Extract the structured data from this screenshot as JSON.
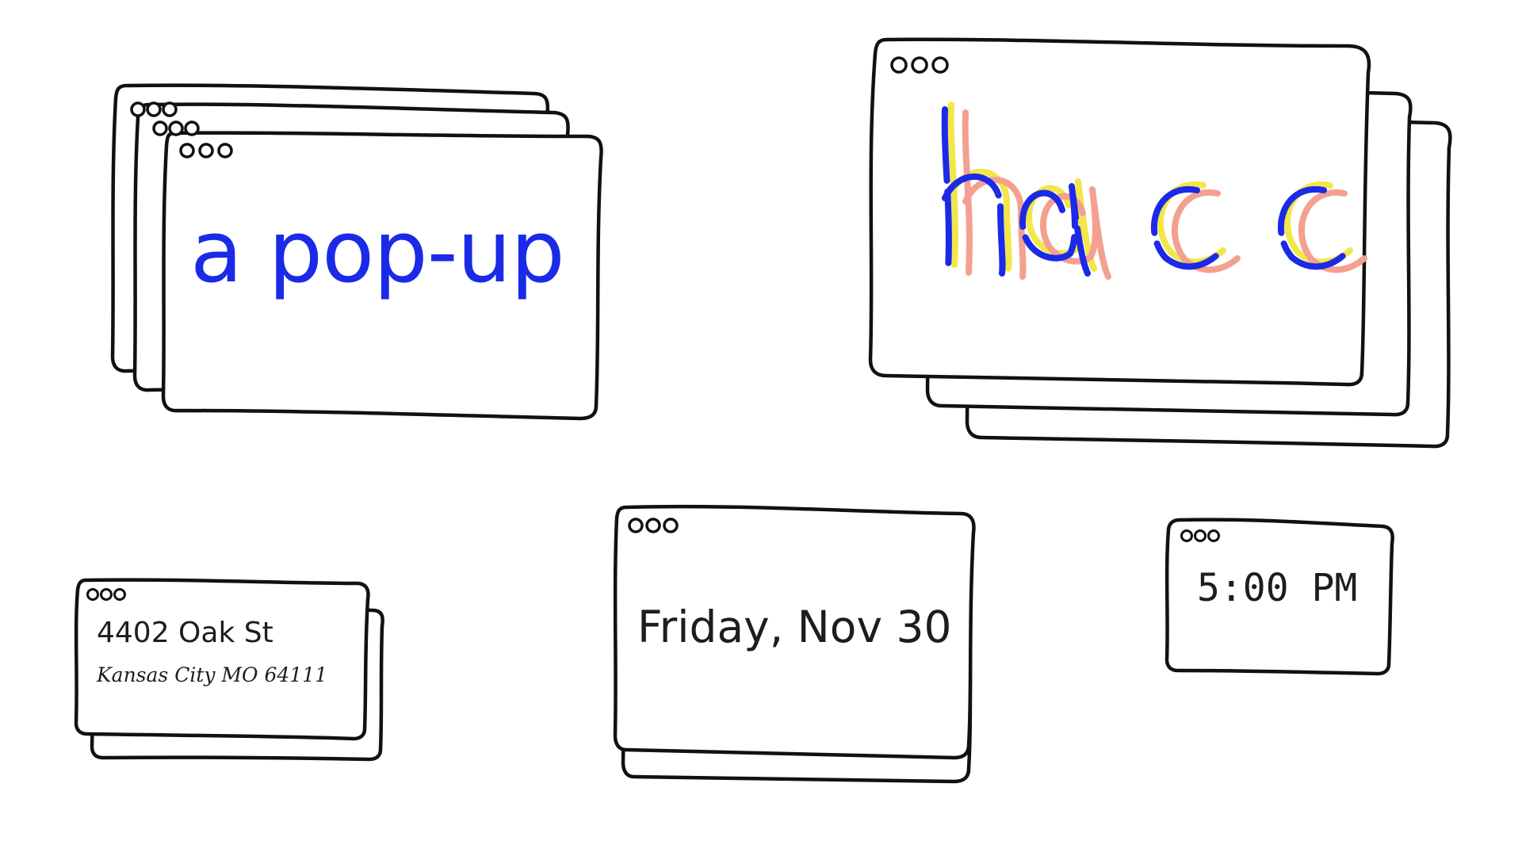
{
  "popup_window": {
    "text": "a pop-up"
  },
  "hacc_window": {
    "text": "hacc",
    "colors": {
      "blue": "#1b2ae6",
      "yellow": "#f2e64a",
      "pink": "#f4a091"
    }
  },
  "address_window": {
    "line1": "4402 Oak St",
    "line2": "Kansas City MO 64111"
  },
  "date_window": {
    "text": "Friday, Nov 30"
  },
  "time_window": {
    "text": "5:00 PM"
  },
  "colors": {
    "ink": "#1d1d1d",
    "accent": "#1b2ae6",
    "background": "#ffffff"
  }
}
